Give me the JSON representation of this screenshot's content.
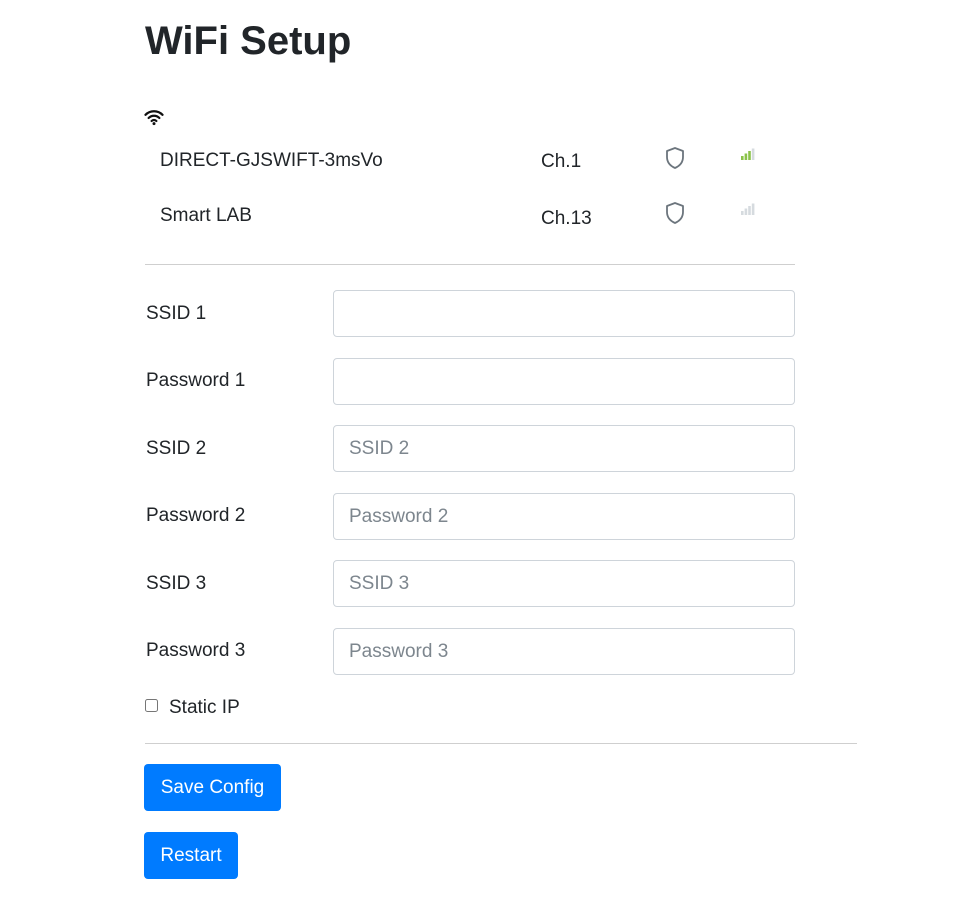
{
  "page": {
    "title": "WiFi Setup"
  },
  "networks": [
    {
      "ssid": "DIRECT-GJSWIFT-3msVo",
      "channel": "Ch.1",
      "secured": true,
      "signal_bars": 3
    },
    {
      "ssid": "Smart LAB",
      "channel": "Ch.13",
      "secured": true,
      "signal_bars": 0
    }
  ],
  "form": {
    "fields": [
      {
        "label": "SSID 1",
        "value": "",
        "placeholder": ""
      },
      {
        "label": "Password 1",
        "value": "",
        "placeholder": ""
      },
      {
        "label": "SSID 2",
        "value": "",
        "placeholder": "SSID 2"
      },
      {
        "label": "Password 2",
        "value": "",
        "placeholder": "Password 2"
      },
      {
        "label": "SSID 3",
        "value": "",
        "placeholder": "SSID 3"
      },
      {
        "label": "Password 3",
        "value": "",
        "placeholder": "Password 3"
      }
    ],
    "static_ip": {
      "label": "Static IP",
      "checked": false
    }
  },
  "actions": {
    "save_label": "Save Config",
    "restart_label": "Restart"
  },
  "icons": {
    "wifi": "wifi-icon",
    "lock": "shield-lock-icon",
    "signal": "signal-strength-icon"
  },
  "colors": {
    "primary": "#007bff",
    "signal_active": "#8bc34a",
    "signal_inactive": "#d6dbdf",
    "shield": "#6c757d"
  }
}
